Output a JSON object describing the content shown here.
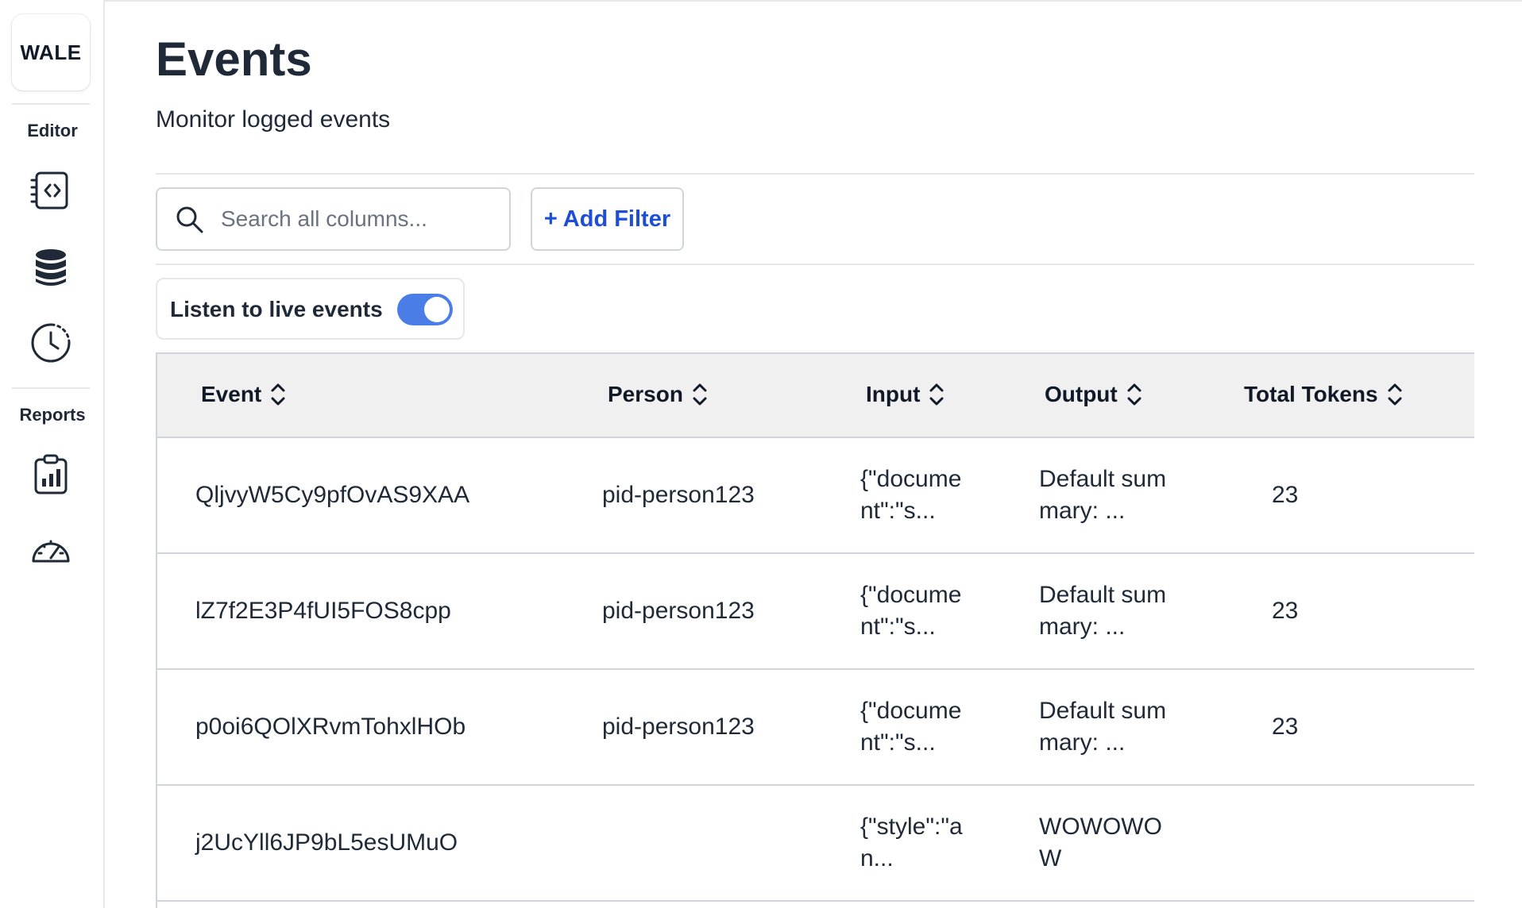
{
  "sidebar": {
    "logo": "WALE",
    "sections": [
      {
        "label": "Editor",
        "icons": [
          "code-file-icon",
          "database-icon",
          "history-clock-icon"
        ]
      },
      {
        "label": "Reports",
        "icons": [
          "clipboard-chart-icon",
          "speedometer-icon"
        ]
      }
    ]
  },
  "page": {
    "title": "Events",
    "subtitle": "Monitor logged events"
  },
  "toolbar": {
    "search_placeholder": "Search all columns...",
    "add_filter_label": "+ Add Filter",
    "live_label": "Listen to live events",
    "live_enabled": true,
    "accent_color": "#4a7ee6",
    "link_color": "#1d4ed8"
  },
  "table": {
    "columns": [
      "Event",
      "Person",
      "Input",
      "Output",
      "Total Tokens"
    ],
    "rows": [
      {
        "event": "QljvyW5Cy9pfOvAS9XAA",
        "person": "pid-person123",
        "input": "{\"document\":\"s...",
        "output": "Default summary: ...",
        "tokens": "23"
      },
      {
        "event": "lZ7f2E3P4fUI5FOS8cpp",
        "person": "pid-person123",
        "input": "{\"document\":\"s...",
        "output": "Default summary: ...",
        "tokens": "23"
      },
      {
        "event": "p0oi6QOlXRvmTohxlHOb",
        "person": "pid-person123",
        "input": "{\"document\":\"s...",
        "output": "Default summary: ...",
        "tokens": "23"
      },
      {
        "event": "j2UcYll6JP9bL5esUMuO",
        "person": "",
        "input": "{\"style\":\"an...",
        "output": "WOWOWOW",
        "tokens": ""
      }
    ]
  }
}
